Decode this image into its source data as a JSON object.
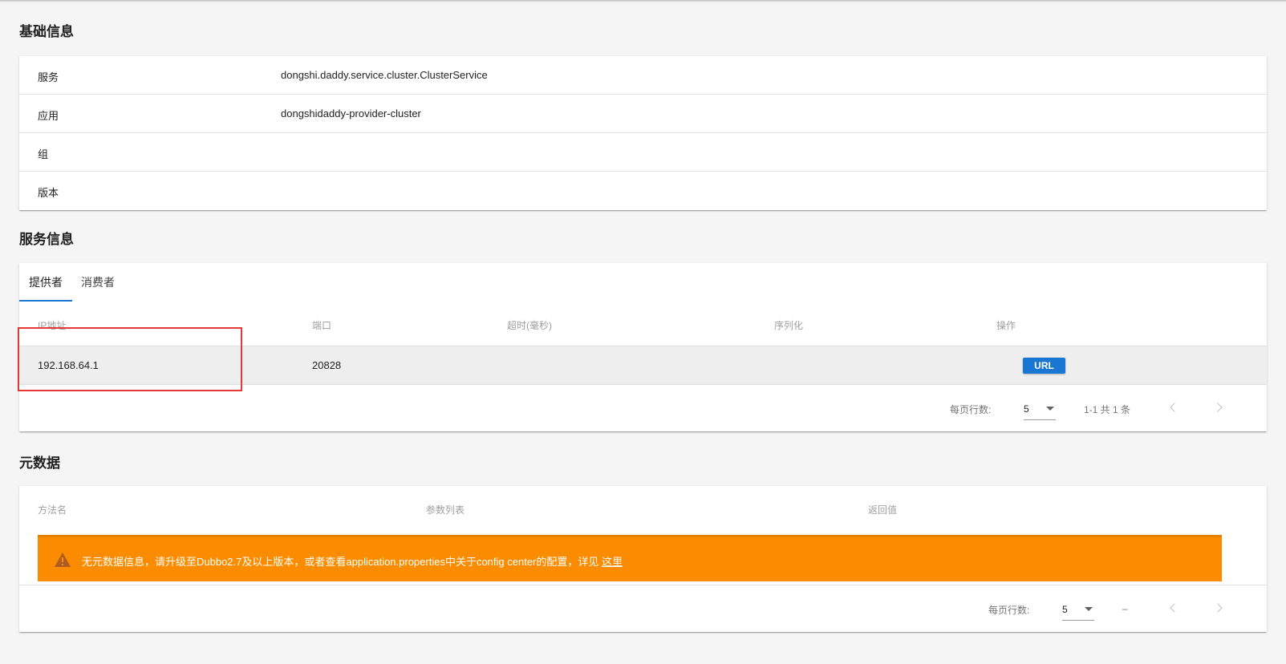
{
  "basic_info": {
    "title": "基础信息",
    "rows": [
      {
        "key": "服务",
        "value": "dongshi.daddy.service.cluster.ClusterService"
      },
      {
        "key": "应用",
        "value": "dongshidaddy-provider-cluster"
      },
      {
        "key": "组",
        "value": ""
      },
      {
        "key": "版本",
        "value": ""
      }
    ]
  },
  "service_info": {
    "title": "服务信息",
    "tabs": [
      {
        "label": "提供者",
        "active": true
      },
      {
        "label": "消费者",
        "active": false
      }
    ],
    "columns": [
      "IP地址",
      "端口",
      "超时(毫秒)",
      "序列化",
      "操作"
    ],
    "rows": [
      {
        "ip": "192.168.64.1",
        "port": "20828",
        "timeout": "",
        "serialization": "",
        "action_label": "URL"
      }
    ],
    "footer": {
      "rows_per_page_label": "每页行数:",
      "rows_per_page_value": "5",
      "page_info": "1-1 共 1 条"
    }
  },
  "metadata": {
    "title": "元数据",
    "columns": [
      "方法名",
      "参数列表",
      "返回值"
    ],
    "alert": {
      "text": "无元数据信息，请升级至Dubbo2.7及以上版本，或者查看application.properties中关于config center的配置，详见 ",
      "link_text": "这里",
      "icon": "warning-icon",
      "color": "#fb8c00"
    },
    "footer": {
      "rows_per_page_label": "每页行数:",
      "rows_per_page_value": "5",
      "page_info": "–"
    }
  },
  "colors": {
    "accent": "#1976d2",
    "highlight": "#e53935",
    "warning": "#fb8c00"
  }
}
